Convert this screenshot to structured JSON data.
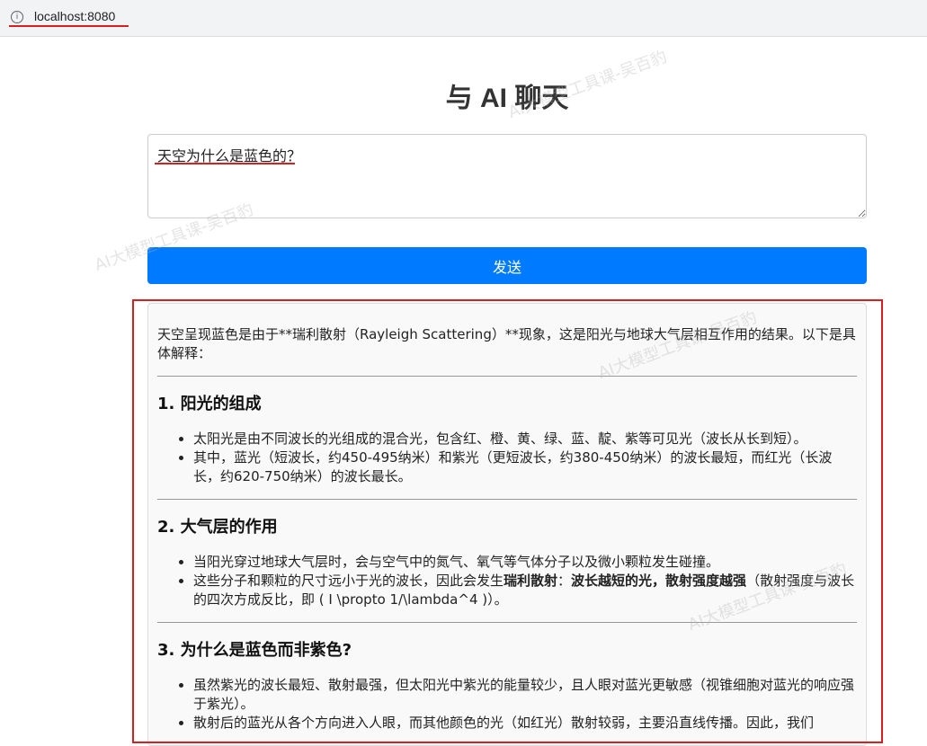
{
  "browser": {
    "url": "localhost:8080",
    "info_icon": "info-icon"
  },
  "page": {
    "title": "与 AI 聊天"
  },
  "question": {
    "value": "天空为什么是蓝色的？"
  },
  "send_button": {
    "label": "发送"
  },
  "response": {
    "intro": "天空呈现蓝色是由于**瑞利散射（Rayleigh Scattering）**现象，这是阳光与地球大气层相互作用的结果。以下是具体解释：",
    "sections": [
      {
        "heading": "1. 阳光的组成",
        "items": [
          "太阳光是由不同波长的光组成的混合光，包含红、橙、黄、绿、蓝、靛、紫等可见光（波长从长到短）。",
          "其中，蓝光（短波长，约450-495纳米）和紫光（更短波长，约380-450纳米）的波长最短，而红光（长波长，约620-750纳米）的波长最长。"
        ]
      },
      {
        "heading": "2. 大气层的作用",
        "item1": "当阳光穿过地球大气层时，会与空气中的氮气、氧气等气体分子以及微小颗粒发生碰撞。",
        "item2_pre": "这些分子和颗粒的尺寸远小于光的波长，因此会发生",
        "item2_bold1": "瑞利散射",
        "item2_mid": "：",
        "item2_bold2": "波长越短的光，散射强度越强",
        "item2_post": "（散射强度与波长的四次方成反比，即 ( I \\propto 1/\\lambda^4 )）。"
      },
      {
        "heading": "3. 为什么是蓝色而非紫色?",
        "items": [
          "虽然紫光的波长最短、散射最强，但太阳光中紫光的能量较少，且人眼对蓝光更敏感（视锥细胞对蓝光的响应强于紫光）。",
          "散射后的蓝光从各个方向进入人眼，而其他颜色的光（如红光）散射较弱，主要沿直线传播。因此，我们"
        ]
      }
    ]
  },
  "watermark": {
    "text": "AI大模型工具课-吴百豹"
  },
  "colors": {
    "send_button": "#007bff",
    "annotation_red": "#d81e1e"
  }
}
